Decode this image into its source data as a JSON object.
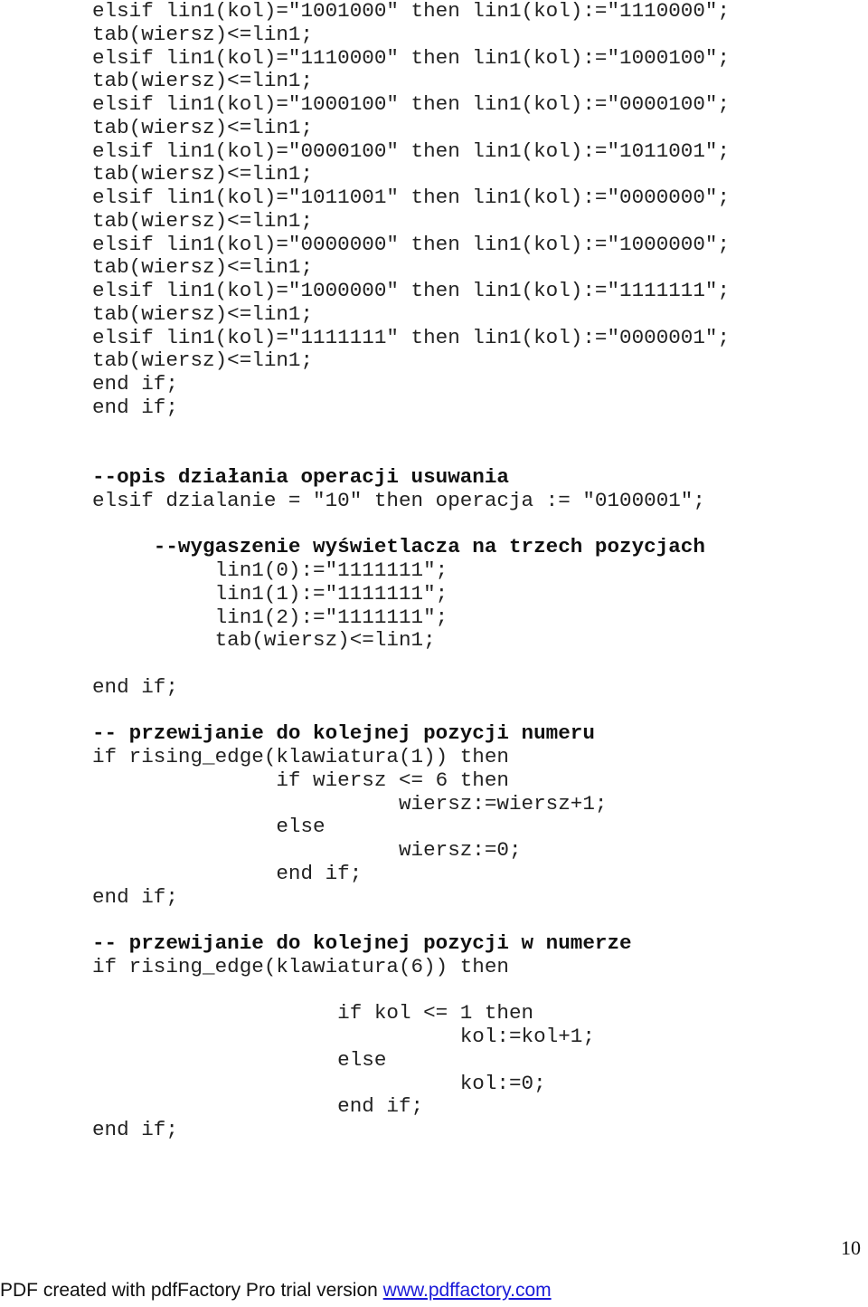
{
  "code_lines": [
    {
      "text": "elsif lin1(kol)=\"1001000\" then lin1(kol):=\"1110000\";",
      "bold": false
    },
    {
      "text": "tab(wiersz)<=lin1;",
      "bold": false
    },
    {
      "text": "elsif lin1(kol)=\"1110000\" then lin1(kol):=\"1000100\";",
      "bold": false
    },
    {
      "text": "tab(wiersz)<=lin1;",
      "bold": false
    },
    {
      "text": "elsif lin1(kol)=\"1000100\" then lin1(kol):=\"0000100\";",
      "bold": false
    },
    {
      "text": "tab(wiersz)<=lin1;",
      "bold": false
    },
    {
      "text": "elsif lin1(kol)=\"0000100\" then lin1(kol):=\"1011001\";",
      "bold": false
    },
    {
      "text": "tab(wiersz)<=lin1;",
      "bold": false
    },
    {
      "text": "elsif lin1(kol)=\"1011001\" then lin1(kol):=\"0000000\";",
      "bold": false
    },
    {
      "text": "tab(wiersz)<=lin1;",
      "bold": false
    },
    {
      "text": "elsif lin1(kol)=\"0000000\" then lin1(kol):=\"1000000\";",
      "bold": false
    },
    {
      "text": "tab(wiersz)<=lin1;",
      "bold": false
    },
    {
      "text": "elsif lin1(kol)=\"1000000\" then lin1(kol):=\"1111111\";",
      "bold": false
    },
    {
      "text": "tab(wiersz)<=lin1;",
      "bold": false
    },
    {
      "text": "elsif lin1(kol)=\"1111111\" then lin1(kol):=\"0000001\";",
      "bold": false
    },
    {
      "text": "tab(wiersz)<=lin1;",
      "bold": false
    },
    {
      "text": "end if;",
      "bold": false
    },
    {
      "text": "end if;",
      "bold": false
    },
    {
      "text": "",
      "bold": false
    },
    {
      "text": "",
      "bold": false
    },
    {
      "text": "--opis działania operacji usuwania",
      "bold": true
    },
    {
      "text": "elsif dzialanie = \"10\" then operacja := \"0100001\";",
      "bold": false
    },
    {
      "text": "",
      "bold": false
    },
    {
      "text": "     --wygaszenie wyświetlacza na trzech pozycjach",
      "bold": true
    },
    {
      "text": "          lin1(0):=\"1111111\";",
      "bold": false
    },
    {
      "text": "          lin1(1):=\"1111111\";",
      "bold": false
    },
    {
      "text": "          lin1(2):=\"1111111\";",
      "bold": false
    },
    {
      "text": "          tab(wiersz)<=lin1;",
      "bold": false
    },
    {
      "text": "",
      "bold": false
    },
    {
      "text": "end if;",
      "bold": false
    },
    {
      "text": "",
      "bold": false
    },
    {
      "text": "-- przewijanie do kolejnej pozycji numeru",
      "bold": true
    },
    {
      "text": "if rising_edge(klawiatura(1)) then",
      "bold": false
    },
    {
      "text": "               if wiersz <= 6 then",
      "bold": false
    },
    {
      "text": "                         wiersz:=wiersz+1;",
      "bold": false
    },
    {
      "text": "               else",
      "bold": false
    },
    {
      "text": "                         wiersz:=0;",
      "bold": false
    },
    {
      "text": "               end if;",
      "bold": false
    },
    {
      "text": "end if;",
      "bold": false
    },
    {
      "text": "",
      "bold": false
    },
    {
      "text": "-- przewijanie do kolejnej pozycji w numerze",
      "bold": true
    },
    {
      "text": "if rising_edge(klawiatura(6)) then",
      "bold": false
    },
    {
      "text": "",
      "bold": false
    },
    {
      "text": "                    if kol <= 1 then",
      "bold": false
    },
    {
      "text": "                              kol:=kol+1;",
      "bold": false
    },
    {
      "text": "                    else",
      "bold": false
    },
    {
      "text": "                              kol:=0;",
      "bold": false
    },
    {
      "text": "                    end if;",
      "bold": false
    },
    {
      "text": "end if;",
      "bold": false
    }
  ],
  "page_number": "10",
  "footer": {
    "text": "PDF created with pdfFactory Pro trial version ",
    "link_text": "www.pdffactory.com"
  }
}
